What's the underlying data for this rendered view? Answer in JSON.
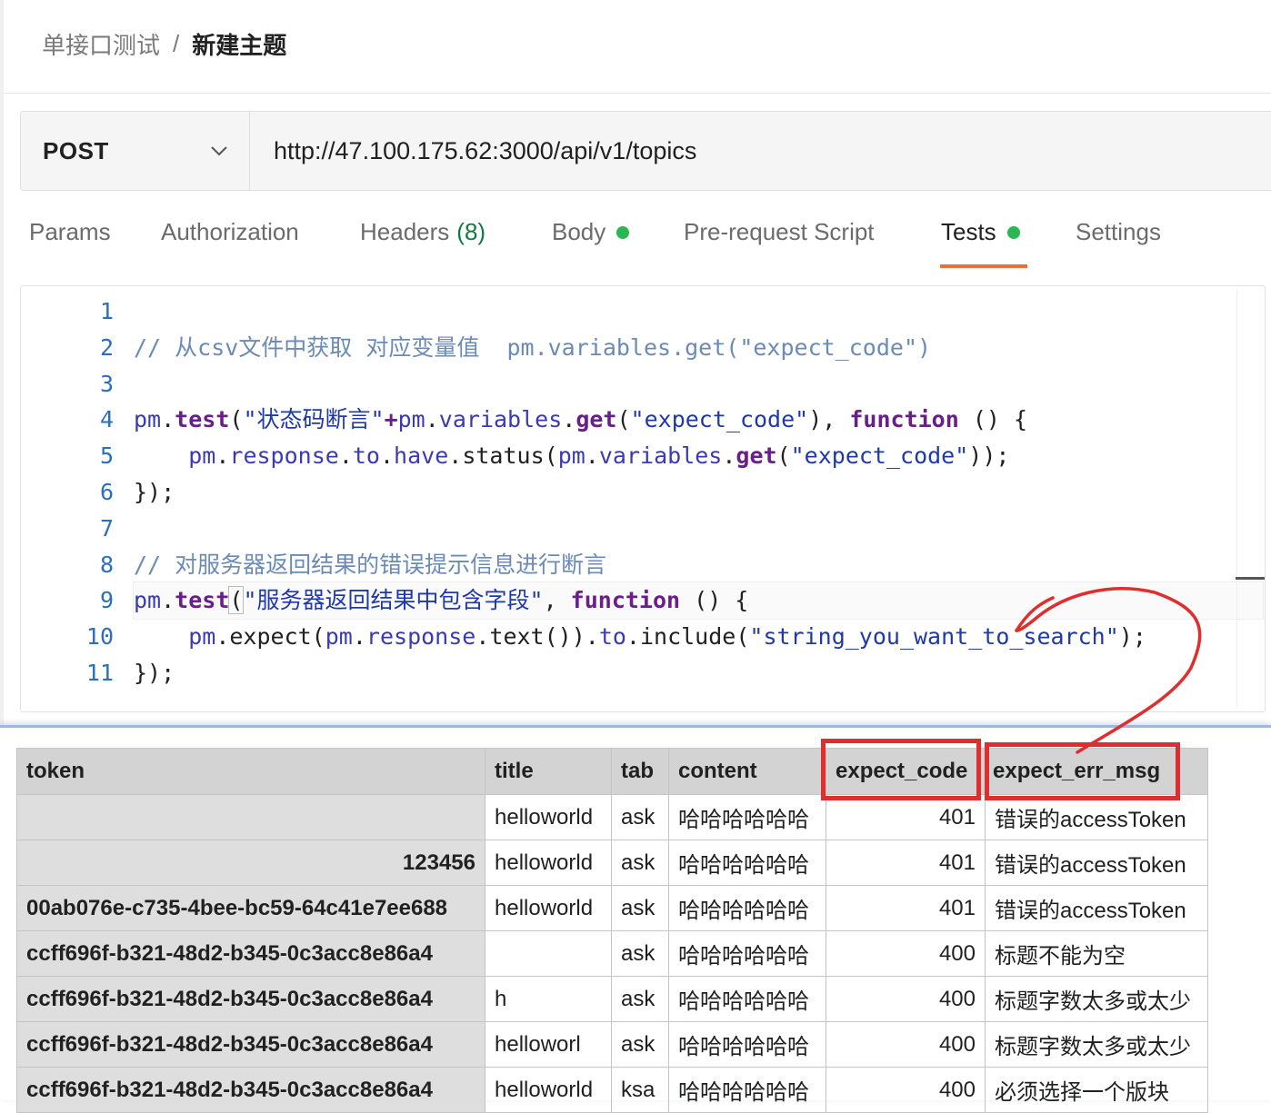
{
  "breadcrumb": {
    "parent": "单接口测试",
    "separator": "/",
    "current": "新建主题"
  },
  "request": {
    "method": "POST",
    "url": "http://47.100.175.62:3000/api/v1/topics"
  },
  "tabs": [
    {
      "label": "Params"
    },
    {
      "label": "Authorization"
    },
    {
      "label": "Headers",
      "count": "(8)"
    },
    {
      "label": "Body",
      "dot": true
    },
    {
      "label": "Pre-request Script"
    },
    {
      "label": "Tests",
      "dot": true,
      "active": true
    },
    {
      "label": "Settings"
    }
  ],
  "editor": {
    "line_numbers": [
      "1",
      "2",
      "3",
      "4",
      "5",
      "6",
      "7",
      "8",
      "9",
      "10",
      "11"
    ],
    "lines": {
      "l2": "// 从csv文件中获取 对应变量值  pm.variables.get(\"expect_code\")",
      "l4a": "pm",
      "l4b": ".",
      "l4c": "test",
      "l4d": "(",
      "l4e": "\"状态码断言\"",
      "l4f": "+",
      "l4g": "pm",
      "l4h": ".",
      "l4i": "variables",
      "l4j": ".",
      "l4k": "get",
      "l4l": "(",
      "l4m": "\"expect_code\"",
      "l4n": "), ",
      "l4o": "function",
      "l4p": " () {",
      "l5a": "    ",
      "l5b": "pm",
      "l5c": ".",
      "l5d": "response",
      "l5e": ".",
      "l5f": "to",
      "l5g": ".",
      "l5h": "have",
      "l5i": ".status(",
      "l5j": "pm",
      "l5k": ".",
      "l5l": "variables",
      "l5m": ".",
      "l5n": "get",
      "l5o": "(",
      "l5p": "\"expect_code\"",
      "l5q": "));",
      "l6": "});",
      "l8": "// 对服务器返回结果的错误提示信息进行断言",
      "l9a": "pm",
      "l9b": ".",
      "l9c": "test",
      "l9d": "(",
      "l9e": "\"服务器返回结果中包含字段\"",
      "l9f": ", ",
      "l9g": "function",
      "l9h": " () {",
      "l10a": "    ",
      "l10b": "pm",
      "l10c": ".expect(",
      "l10d": "pm",
      "l10e": ".",
      "l10f": "response",
      "l10g": ".text()).",
      "l10h": "to",
      "l10i": ".include(",
      "l10j": "\"string_you_want_to_search\"",
      "l10k": ");",
      "l11": "});"
    }
  },
  "csv_table": {
    "headers": [
      "token",
      "title",
      "tab",
      "content",
      "expect_code",
      "expect_err_msg"
    ],
    "rows": [
      [
        "",
        "helloworld",
        "ask",
        "哈哈哈哈哈哈",
        "401",
        "错误的accessToken"
      ],
      [
        "123456",
        "helloworld",
        "ask",
        "哈哈哈哈哈哈",
        "401",
        "错误的accessToken"
      ],
      [
        "00ab076e-c735-4bee-bc59-64c41e7ee688",
        "helloworld",
        "ask",
        "哈哈哈哈哈哈",
        "401",
        "错误的accessToken"
      ],
      [
        "ccff696f-b321-48d2-b345-0c3acc8e86a4",
        "",
        "ask",
        "哈哈哈哈哈哈",
        "400",
        "标题不能为空"
      ],
      [
        "ccff696f-b321-48d2-b345-0c3acc8e86a4",
        "h",
        "ask",
        "哈哈哈哈哈哈",
        "400",
        "标题字数太多或太少"
      ],
      [
        "ccff696f-b321-48d2-b345-0c3acc8e86a4",
        "helloworl",
        "ask",
        "哈哈哈哈哈哈",
        "400",
        "标题字数太多或太少"
      ],
      [
        "ccff696f-b321-48d2-b345-0c3acc8e86a4",
        "helloworld",
        "ksa",
        "哈哈哈哈哈哈",
        "400",
        "必须选择一个版块"
      ]
    ]
  },
  "annotation_color": "#e02d2d",
  "accent_color": "#f26b3a",
  "dot_color": "#2ab650"
}
